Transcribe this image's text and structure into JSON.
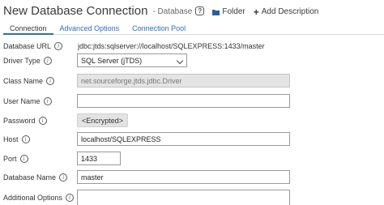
{
  "header": {
    "title": "New Database Connection",
    "subtitle": "- Database",
    "help_glyph": "?",
    "folder_label": "Folder",
    "add_description_label": "Add Description"
  },
  "tabs": [
    {
      "label": "Connection",
      "active": true
    },
    {
      "label": "Advanced Options",
      "active": false
    },
    {
      "label": "Connection Pool",
      "active": false
    }
  ],
  "form": {
    "database_url": {
      "label": "Database URL",
      "value": "jdbc:jtds:sqlserver://localhost/SQLEXPRESS:1433/master"
    },
    "driver_type": {
      "label": "Driver Type",
      "value": "SQL Server (jTDS)"
    },
    "class_name": {
      "label": "Class Name",
      "value": "net.sourceforge.jtds.jdbc.Driver"
    },
    "user_name": {
      "label": "User Name",
      "value": ""
    },
    "password": {
      "label": "Password",
      "button_label": "<Encrypted>"
    },
    "host": {
      "label": "Host",
      "value": "localhost/SQLEXPRESS"
    },
    "port": {
      "label": "Port",
      "value": "1433"
    },
    "database_name": {
      "label": "Database Name",
      "value": "master"
    },
    "additional_options": {
      "label": "Additional Options",
      "value": ""
    }
  },
  "info_glyph": "i",
  "icons": {
    "help": "help-icon",
    "folder": "folder-icon",
    "add": "plus-icon",
    "info": "info-icon",
    "dropdown": "chevron-down-icon"
  },
  "colors": {
    "link": "#2a6ebb",
    "active_tab_underline": "#2a6ebb",
    "disabled_field": "#e4e4e4",
    "folder_icon": "#2a5d9f"
  }
}
